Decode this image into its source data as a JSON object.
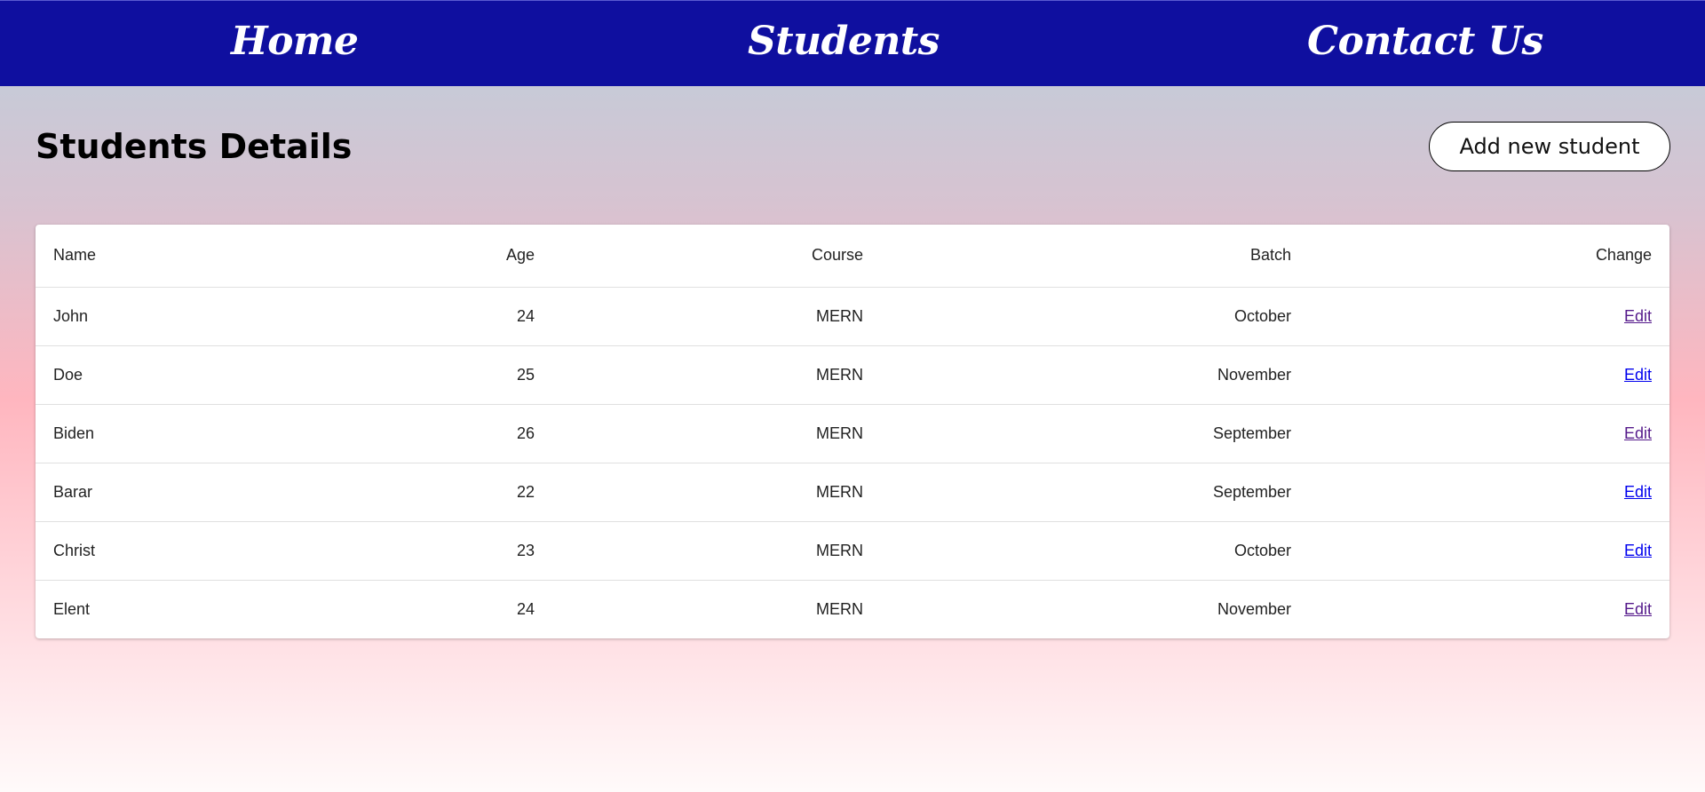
{
  "nav": {
    "home": "Home",
    "students": "Students",
    "contact": "Contact Us"
  },
  "page": {
    "title": "Students Details",
    "add_button": "Add new student"
  },
  "table": {
    "headers": [
      "Name",
      "Age",
      "Course",
      "Batch",
      "Change"
    ],
    "rows": [
      {
        "name": "John",
        "age": "24",
        "course": "MERN",
        "batch": "October",
        "change": "Edit"
      },
      {
        "name": "Doe",
        "age": "25",
        "course": "MERN",
        "batch": "November",
        "change": "Edit"
      },
      {
        "name": "Biden",
        "age": "26",
        "course": "MERN",
        "batch": "September",
        "change": "Edit"
      },
      {
        "name": "Barar",
        "age": "22",
        "course": "MERN",
        "batch": "September",
        "change": "Edit"
      },
      {
        "name": "Christ",
        "age": "23",
        "course": "MERN",
        "batch": "October",
        "change": "Edit"
      },
      {
        "name": "Elent",
        "age": "24",
        "course": "MERN",
        "batch": "November",
        "change": "Edit"
      }
    ]
  },
  "colors": {
    "navbar": "#0f0f9f",
    "link_visited": "#551a8b",
    "link_unvisited": "#0000ee"
  }
}
